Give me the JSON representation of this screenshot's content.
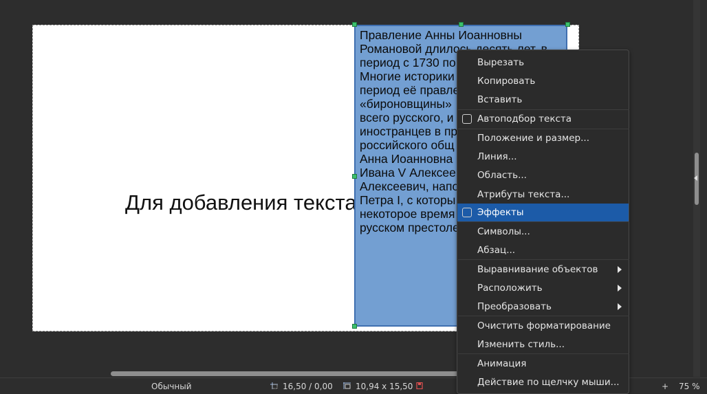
{
  "slide": {
    "placeholder": "Для добавления текста щ",
    "textbox_lines": [
      "Правление Анны Иоанновны",
      "Романовой длилось десять лет, в",
      "период с 1730 по",
      "Многие историки",
      "период её правле",
      "«бироновщины»",
      "всего русского, и",
      "иностранцев в пр",
      "российского общ",
      "Анна Иоанновна",
      "Ивана V Алексее",
      "Алексеевич, напо",
      "Петра I, с которы",
      "некоторое время",
      "русском престоле"
    ]
  },
  "context_menu": {
    "cut": "Вырезать",
    "copy": "Копировать",
    "paste": "Вставить",
    "autofit": "Автоподбор текста",
    "position_size": "Положение и размер...",
    "line": "Линия...",
    "area": "Область...",
    "text_attributes": "Атрибуты текста...",
    "effects": "Эффекты",
    "characters": "Символы...",
    "paragraph": "Абзац...",
    "align_objects": "Выравнивание объектов",
    "arrange": "Расположить",
    "convert": "Преобразовать",
    "clear_formatting": "Очистить форматирование",
    "edit_style": "Изменить стиль...",
    "animation": "Анимация",
    "interaction": "Действие по щелчку мыши..."
  },
  "statusbar": {
    "layout": "Обычный",
    "position": "16,50 / 0,00",
    "size": "10,94 x 15,50",
    "zoom_plus": "+",
    "zoom": "75 %"
  },
  "colors": {
    "highlight": "#1c5ba8",
    "textbox_fill": "#739fd2",
    "handle": "#3cc06c"
  },
  "icons": [
    "checkbox-icon",
    "submenu-arrow-icon",
    "position-icon",
    "size-icon",
    "save-status-icon"
  ]
}
